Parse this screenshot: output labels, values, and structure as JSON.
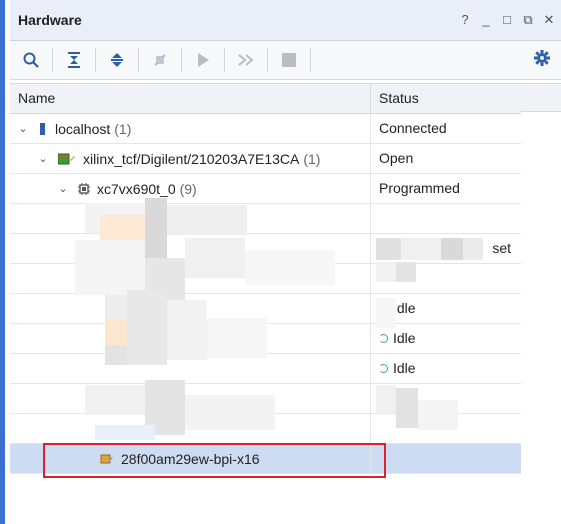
{
  "window": {
    "title": "Hardware",
    "controls": [
      "?",
      "_",
      "□",
      "⧉",
      "✕"
    ]
  },
  "toolbar": {
    "icons": [
      "search-icon",
      "collapse-all-icon",
      "expand-all-icon",
      "auto-connect-icon",
      "run-icon",
      "run-all-icon",
      "stop-icon"
    ],
    "settings_icon": "gear-icon"
  },
  "table": {
    "headers": [
      "Name",
      "Status"
    ],
    "rows": [
      {
        "name": "localhost",
        "count": "(1)",
        "status": "Connected"
      },
      {
        "name": "xilinx_tcf/Digilent/210203A7E13CA",
        "count": "(1)",
        "status": "Open"
      },
      {
        "name": "xc7vx690t_0",
        "count": "(9)",
        "status": "Programmed"
      },
      {
        "name": "",
        "count": "",
        "status": ""
      },
      {
        "name": "",
        "count": "",
        "status": "set"
      },
      {
        "name": "",
        "count": "",
        "status": ""
      },
      {
        "name": "",
        "count": "",
        "status": "Idle"
      },
      {
        "name": "",
        "count": "",
        "status": "Idle"
      },
      {
        "name": "",
        "count": "",
        "status": "Idle"
      },
      {
        "name": "",
        "count": "",
        "status": ""
      },
      {
        "name": "",
        "count": "",
        "status": ""
      },
      {
        "name": "28f00am29ew-bpi-x16",
        "count": "",
        "status": ""
      }
    ]
  },
  "colors": {
    "accent": "#3b6fd0",
    "selection": "#cddcf3",
    "highlight_box": "#d9232d"
  }
}
